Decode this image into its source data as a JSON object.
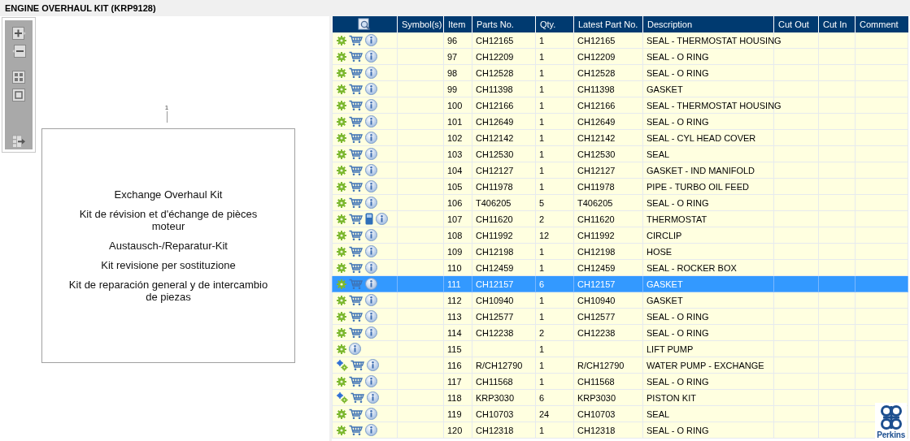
{
  "title": "ENGINE OVERHAUL KIT (KRP9128)",
  "diagram": {
    "callout": "1",
    "lines": [
      "Exchange Overhaul Kit",
      "Kit de révision et d'échange de pièces moteur",
      "Austausch-/Reparatur-Kit",
      "Kit revisione per sostituzione",
      "Kit de reparación general y de intercambio de piezas"
    ]
  },
  "table": {
    "columns": [
      "Symbol(s)",
      "Item",
      "Parts No.",
      "Qty.",
      "Latest Part No.",
      "Description",
      "Cut Out",
      "Cut In",
      "Comment"
    ],
    "rows": [
      {
        "kind": "part",
        "cart": true,
        "manual": false,
        "info": true,
        "item": "96",
        "part": "CH12165",
        "qty": "1",
        "latest": "CH12165",
        "description": "SEAL - THERMOSTAT HOUSING",
        "selected": false
      },
      {
        "kind": "part",
        "cart": true,
        "manual": false,
        "info": true,
        "item": "97",
        "part": "CH12209",
        "qty": "1",
        "latest": "CH12209",
        "description": "SEAL - O RING",
        "selected": false
      },
      {
        "kind": "part",
        "cart": true,
        "manual": false,
        "info": true,
        "item": "98",
        "part": "CH12528",
        "qty": "1",
        "latest": "CH12528",
        "description": "SEAL - O RING",
        "selected": false
      },
      {
        "kind": "part",
        "cart": true,
        "manual": false,
        "info": true,
        "item": "99",
        "part": "CH11398",
        "qty": "1",
        "latest": "CH11398",
        "description": "GASKET",
        "selected": false
      },
      {
        "kind": "part",
        "cart": true,
        "manual": false,
        "info": true,
        "item": "100",
        "part": "CH12166",
        "qty": "1",
        "latest": "CH12166",
        "description": "SEAL - THERMOSTAT HOUSING",
        "selected": false
      },
      {
        "kind": "part",
        "cart": true,
        "manual": false,
        "info": true,
        "item": "101",
        "part": "CH12649",
        "qty": "1",
        "latest": "CH12649",
        "description": "SEAL - O RING",
        "selected": false
      },
      {
        "kind": "part",
        "cart": true,
        "manual": false,
        "info": true,
        "item": "102",
        "part": "CH12142",
        "qty": "1",
        "latest": "CH12142",
        "description": "SEAL - CYL HEAD COVER",
        "selected": false
      },
      {
        "kind": "part",
        "cart": true,
        "manual": false,
        "info": true,
        "item": "103",
        "part": "CH12530",
        "qty": "1",
        "latest": "CH12530",
        "description": "SEAL",
        "selected": false
      },
      {
        "kind": "part",
        "cart": true,
        "manual": false,
        "info": true,
        "item": "104",
        "part": "CH12127",
        "qty": "1",
        "latest": "CH12127",
        "description": "GASKET - IND MANIFOLD",
        "selected": false
      },
      {
        "kind": "part",
        "cart": true,
        "manual": false,
        "info": true,
        "item": "105",
        "part": "CH11978",
        "qty": "1",
        "latest": "CH11978",
        "description": "PIPE - TURBO OIL FEED",
        "selected": false
      },
      {
        "kind": "part",
        "cart": true,
        "manual": false,
        "info": true,
        "item": "106",
        "part": "T406205",
        "qty": "5",
        "latest": "T406205",
        "description": "SEAL - O RING",
        "selected": false
      },
      {
        "kind": "part",
        "cart": true,
        "manual": true,
        "info": true,
        "item": "107",
        "part": "CH11620",
        "qty": "2",
        "latest": "CH11620",
        "description": "THERMOSTAT",
        "selected": false
      },
      {
        "kind": "part",
        "cart": true,
        "manual": false,
        "info": true,
        "item": "108",
        "part": "CH11992",
        "qty": "12",
        "latest": "CH11992",
        "description": "CIRCLIP",
        "selected": false
      },
      {
        "kind": "part",
        "cart": true,
        "manual": false,
        "info": true,
        "item": "109",
        "part": "CH12198",
        "qty": "1",
        "latest": "CH12198",
        "description": "HOSE",
        "selected": false
      },
      {
        "kind": "part",
        "cart": true,
        "manual": false,
        "info": true,
        "item": "110",
        "part": "CH12459",
        "qty": "1",
        "latest": "CH12459",
        "description": "SEAL - ROCKER BOX",
        "selected": false
      },
      {
        "kind": "part",
        "cart": true,
        "manual": false,
        "info": true,
        "item": "111",
        "part": "CH12157",
        "qty": "6",
        "latest": "CH12157",
        "description": "GASKET",
        "selected": true
      },
      {
        "kind": "part",
        "cart": true,
        "manual": false,
        "info": true,
        "item": "112",
        "part": "CH10940",
        "qty": "1",
        "latest": "CH10940",
        "description": "GASKET",
        "selected": false
      },
      {
        "kind": "part",
        "cart": true,
        "manual": false,
        "info": true,
        "item": "113",
        "part": "CH12577",
        "qty": "1",
        "latest": "CH12577",
        "description": "SEAL - O RING",
        "selected": false
      },
      {
        "kind": "part",
        "cart": true,
        "manual": false,
        "info": true,
        "item": "114",
        "part": "CH12238",
        "qty": "2",
        "latest": "CH12238",
        "description": "SEAL - O RING",
        "selected": false
      },
      {
        "kind": "part",
        "cart": false,
        "manual": false,
        "info": true,
        "item": "115",
        "qty": "1",
        "description": "LIFT PUMP",
        "selected": false
      },
      {
        "kind": "assembly",
        "cart": true,
        "manual": false,
        "info": true,
        "item": "116",
        "part": "R/CH12790",
        "qty": "1",
        "latest": "R/CH12790",
        "description": "WATER PUMP - EXCHANGE",
        "selected": false
      },
      {
        "kind": "part",
        "cart": true,
        "manual": false,
        "info": true,
        "item": "117",
        "part": "CH11568",
        "qty": "1",
        "latest": "CH11568",
        "description": "SEAL - O RING",
        "selected": false
      },
      {
        "kind": "assembly",
        "cart": true,
        "manual": false,
        "info": true,
        "item": "118",
        "part": "KRP3030",
        "qty": "6",
        "latest": "KRP3030",
        "description": "PISTON KIT",
        "selected": false
      },
      {
        "kind": "part",
        "cart": true,
        "manual": false,
        "info": true,
        "item": "119",
        "part": "CH10703",
        "qty": "24",
        "latest": "CH10703",
        "description": "SEAL",
        "selected": false
      },
      {
        "kind": "part",
        "cart": true,
        "manual": false,
        "info": true,
        "item": "120",
        "part": "CH12318",
        "qty": "1",
        "latest": "CH12318",
        "description": "SEAL - O RING",
        "selected": false
      }
    ]
  },
  "logo": {
    "text": "Perkins"
  }
}
